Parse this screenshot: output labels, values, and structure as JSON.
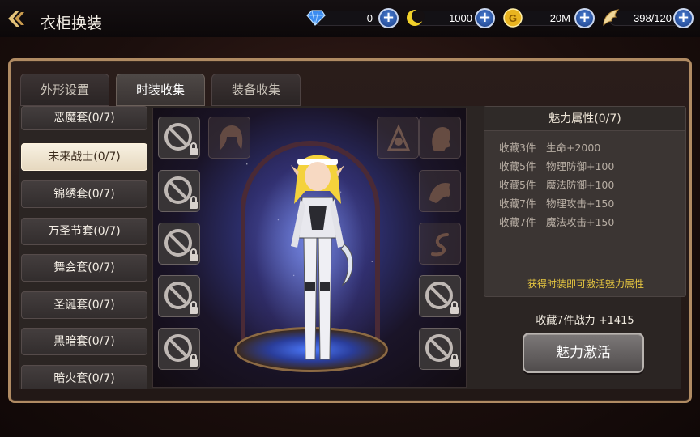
{
  "header": {
    "title": "衣柜换装",
    "resources": [
      {
        "name": "diamond",
        "icon": "blue-diamond-icon",
        "value": "0"
      },
      {
        "name": "crescent",
        "icon": "yellow-crescent-icon",
        "value": "1000"
      },
      {
        "name": "gold",
        "icon": "gold-coin-icon",
        "value": "20M"
      },
      {
        "name": "stamina",
        "icon": "wing-icon",
        "value": "398/120"
      }
    ]
  },
  "tabs": [
    {
      "label": "外形设置",
      "active": false
    },
    {
      "label": "时装收集",
      "active": true
    },
    {
      "label": "装备收集",
      "active": false
    }
  ],
  "sets": [
    {
      "label": "恶魔套(0/7)",
      "selected": false
    },
    {
      "label": "未来战士(0/7)",
      "selected": true
    },
    {
      "label": "锦绣套(0/7)",
      "selected": false
    },
    {
      "label": "万圣节套(0/7)",
      "selected": false
    },
    {
      "label": "舞会套(0/7)",
      "selected": false
    },
    {
      "label": "圣诞套(0/7)",
      "selected": false
    },
    {
      "label": "黑暗套(0/7)",
      "selected": false
    },
    {
      "label": "暗火套(0/7)",
      "selected": false
    }
  ],
  "slots": {
    "left": [
      "locked-slot-icon",
      "locked-slot-icon",
      "locked-slot-icon",
      "locked-slot-icon",
      "locked-slot-icon"
    ],
    "right": [
      "face-icon",
      "hair-icon",
      "tail-icon",
      "locked-slot-icon",
      "locked-slot-icon"
    ],
    "top": [
      "hair-silhouette-icon",
      "aura-icon"
    ]
  },
  "charm": {
    "title": "魅力属性(0/7)",
    "bonuses": [
      {
        "req": "收藏3件",
        "effect": "生命+2000"
      },
      {
        "req": "收藏5件",
        "effect": "物理防御+100"
      },
      {
        "req": "收藏5件",
        "effect": "魔法防御+100"
      },
      {
        "req": "收藏7件",
        "effect": "物理攻击+150"
      },
      {
        "req": "收藏7件",
        "effect": "魔法攻击+150"
      }
    ],
    "hint": "获得时装即可激活魅力属性"
  },
  "power_line": "收藏7件战力 +1415",
  "activate_label": "魅力激活",
  "colors": {
    "frame": "#b08b63",
    "hint": "#e6c640",
    "selected_item": "#f8f1e2",
    "plus_button": "#1b3e86"
  }
}
